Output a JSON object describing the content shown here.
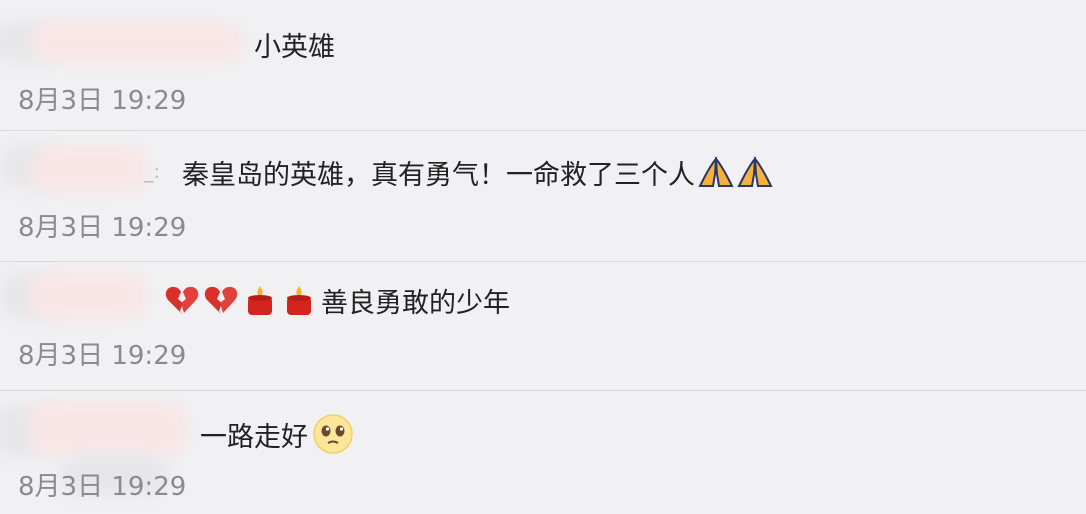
{
  "comments": [
    {
      "text": "小英雄",
      "time": "8月3日 19:29"
    },
    {
      "name_tail": "_:",
      "text": "秦皇岛的英雄，真有勇气！一命救了三个人",
      "emojis": [
        "pray-icon",
        "pray-icon"
      ],
      "time": "8月3日 19:29"
    },
    {
      "text": "善良勇敢的少年",
      "emojis": [
        "broken-heart-icon",
        "broken-heart-icon",
        "candle-icon",
        "candle-icon"
      ],
      "time": "8月3日 19:29"
    },
    {
      "text": "一路走好",
      "emojis": [
        "pleading-face-icon"
      ],
      "time": "8月3日 19:29"
    }
  ]
}
